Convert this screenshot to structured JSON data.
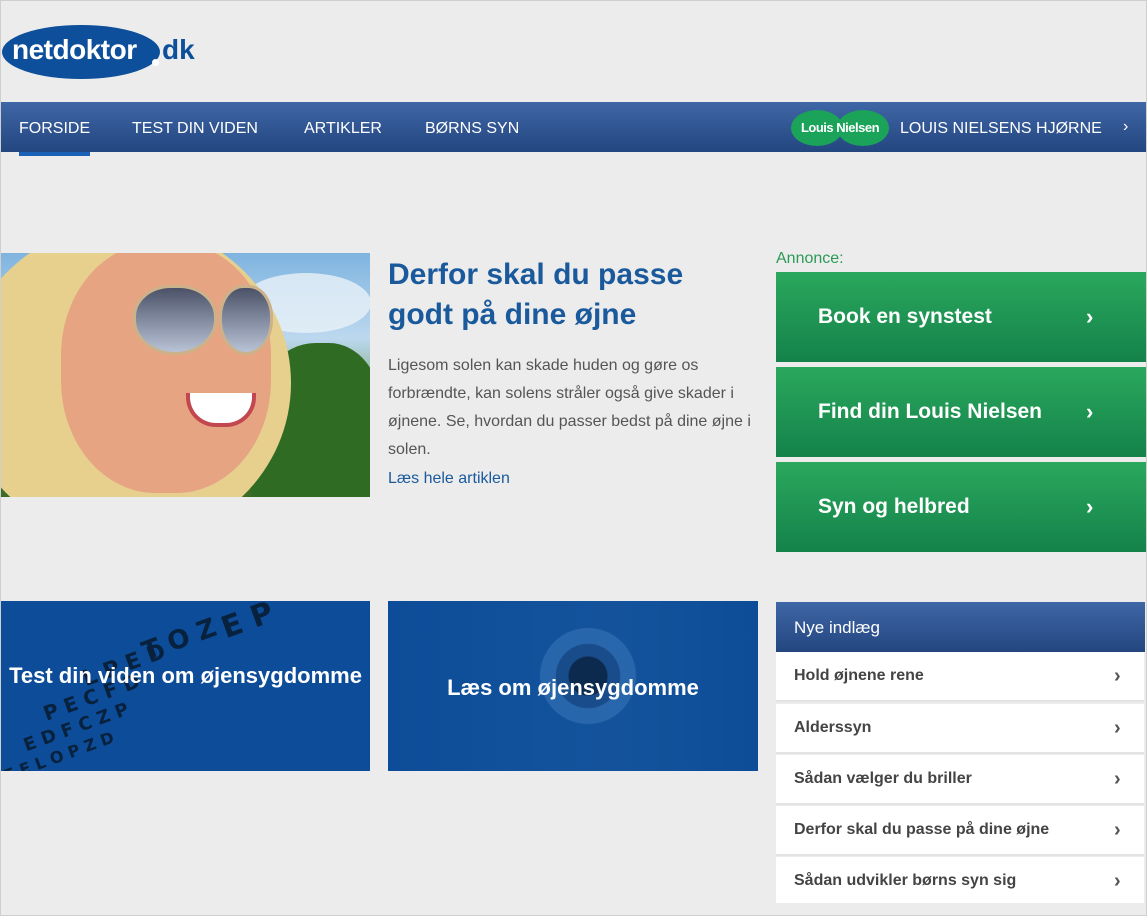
{
  "logo": {
    "main": "netdoktor",
    "tld": "dk"
  },
  "nav": {
    "items": [
      "FORSIDE",
      "TEST DIN VIDEN",
      "ARTIKLER",
      "BØRNS SYN"
    ],
    "badge": "Louis Nielsen",
    "right_label": "LOUIS NIELSENS HJØRNE",
    "chevron": "›"
  },
  "hero": {
    "title": "Derfor skal du passe godt på dine øjne",
    "text": "Ligesom solen kan skade huden og gøre os forbrændte, kan solens stråler også give skader i øjnene. Se, hvordan du passer bedst på dine øjne i solen.",
    "link": "Læs hele artiklen"
  },
  "ad": {
    "label": "Annonce:",
    "buttons": [
      "Book en synstest",
      "Find din Louis Nielsen",
      "Syn og helbred"
    ],
    "chevron": "›"
  },
  "tiles": {
    "test": "Test din viden om øjensygdomme",
    "eye": "Læs om øjensygdomme"
  },
  "sidebar": {
    "heading": "Nye indlæg",
    "items": [
      "Hold øjnene rene",
      "Alderssyn",
      "Sådan vælger du briller",
      "Derfor skal du passe på dine øjne",
      "Sådan udvikler børns syn sig"
    ],
    "chevron": "›"
  },
  "colors": {
    "brand_blue": "#0d4f9a",
    "nav_blue": "#2f5592",
    "ad_green": "#1f9a55"
  },
  "icons": {
    "nav_chevron": "chevron-right-icon",
    "list_chevron": "chevron-right-icon"
  }
}
